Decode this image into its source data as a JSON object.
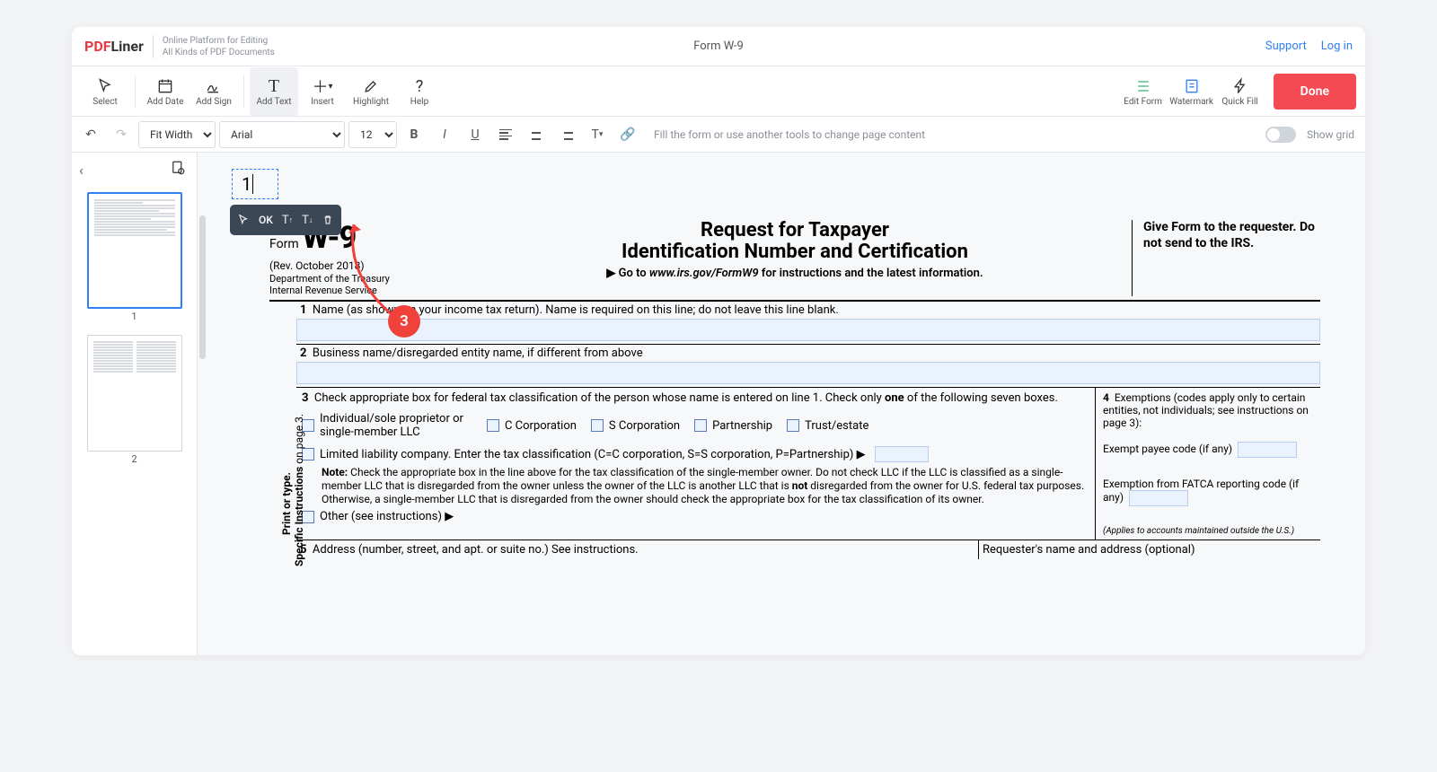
{
  "brand": {
    "red": "PDF",
    "dark": "Liner"
  },
  "tagline_l1": "Online Platform for Editing",
  "tagline_l2": "All Kinds of PDF Documents",
  "doc_title": "Form W-9",
  "links": {
    "support": "Support",
    "login": "Log in"
  },
  "tools": {
    "select": "Select",
    "date": "Add Date",
    "sign": "Add Sign",
    "text": "Add Text",
    "insert": "Insert",
    "highlight": "Highlight",
    "help": "Help",
    "editform": "Edit Form",
    "watermark": "Watermark",
    "quickfill": "Quick Fill"
  },
  "done": "Done",
  "format": {
    "fit": "Fit Width",
    "font": "Arial",
    "size": "12",
    "hint": "Fill the form or use another tools to change page content",
    "showgrid": "Show grid"
  },
  "thumbs": [
    "1",
    "2"
  ],
  "textbox_value": "1",
  "text_toolbar": {
    "ok": "OK"
  },
  "annotation": "3",
  "w9": {
    "form": "Form",
    "big": "W-9",
    "rev": "(Rev. October 2018)",
    "dept1": "Department of the Treasury",
    "dept2": "Internal Revenue Service",
    "title1": "Request for Taxpayer",
    "title2": "Identification Number and Certification",
    "goto_pre": "▶ Go to ",
    "goto_link": "www.irs.gov/FormW9",
    "goto_post": " for instructions and the latest information.",
    "give": "Give Form to the requester. Do not send to the IRS.",
    "side1": "Print or type.",
    "side2": "Specific Instructions",
    "side3": " on page 3.",
    "l1": "Name (as shown on your income tax return). Name is required on this line; do not leave this line blank.",
    "l2": "Business name/disregarded entity name, if different from above",
    "l3a": "Check appropriate box for federal tax classification of the person whose name is entered on line 1. Check only ",
    "l3b": "one",
    "l3c": " of the following seven boxes.",
    "c1": "Individual/sole proprietor or single-member LLC",
    "c2": "C Corporation",
    "c3": "S Corporation",
    "c4": "Partnership",
    "c5": "Trust/estate",
    "llc": "Limited liability company. Enter the tax classification (C=C corporation, S=S corporation, P=Partnership) ▶",
    "note_b": "Note:",
    "note": " Check the appropriate box in the line above for the tax classification of the single-member owner.  Do not check LLC if the LLC is classified as a single-member LLC that is disregarded from the owner unless the owner of the LLC is another LLC that is ",
    "note_b2": "not",
    "note2": " disregarded from the owner for U.S. federal tax purposes. Otherwise, a single-member LLC that is disregarded from the owner should check the appropriate box for the tax classification of its owner.",
    "other": "Other (see instructions) ▶",
    "l4a": "Exemptions (codes apply only to certain entities, not individuals; see instructions on page 3):",
    "l4b": "Exempt payee code (if any)",
    "l4c": "Exemption from FATCA reporting code (if any)",
    "l4d": "(Applies to accounts maintained outside the U.S.)",
    "l5": "Address (number, street, and apt. or suite no.) See instructions.",
    "l5r": "Requester's name and address (optional)"
  }
}
